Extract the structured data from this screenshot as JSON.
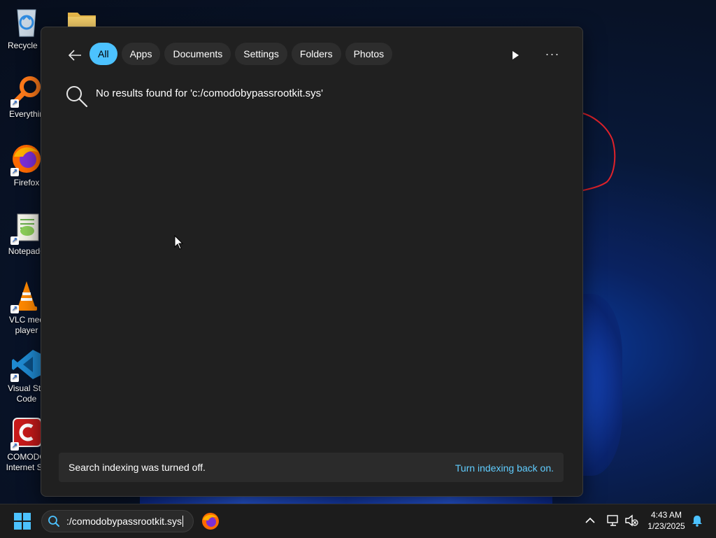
{
  "desktop": {
    "icons": [
      {
        "label": "Recycle B",
        "icon": "recycle-bin-icon"
      },
      {
        "label": "Everythin",
        "icon": "everything-search-icon"
      },
      {
        "label": "Firefox",
        "icon": "firefox-icon"
      },
      {
        "label": "Notepad+",
        "icon": "notepad-plus-plus-icon"
      },
      {
        "label": "VLC med\nplayer",
        "icon": "vlc-cone-icon"
      },
      {
        "label": "Visual Stu\nCode",
        "icon": "vscode-icon"
      },
      {
        "label": "COMODO\nInternet Se",
        "icon": "comodo-icon"
      }
    ],
    "folder_icon": "folder-icon"
  },
  "search_panel": {
    "filters": [
      "All",
      "Apps",
      "Documents",
      "Settings",
      "Folders",
      "Photos"
    ],
    "active_filter": "All",
    "no_results_text": "No results found for 'c:/comodobypassrootkit.sys'",
    "indexing_message": "Search indexing was turned off.",
    "indexing_link": "Turn indexing back on."
  },
  "taskbar": {
    "search_value": ":/comodobypassrootkit.sys",
    "time": "4:43 AM",
    "date": "1/23/2025"
  },
  "colors": {
    "accent": "#4cc2ff",
    "link": "#60cdff",
    "panel_bg": "#202020"
  }
}
